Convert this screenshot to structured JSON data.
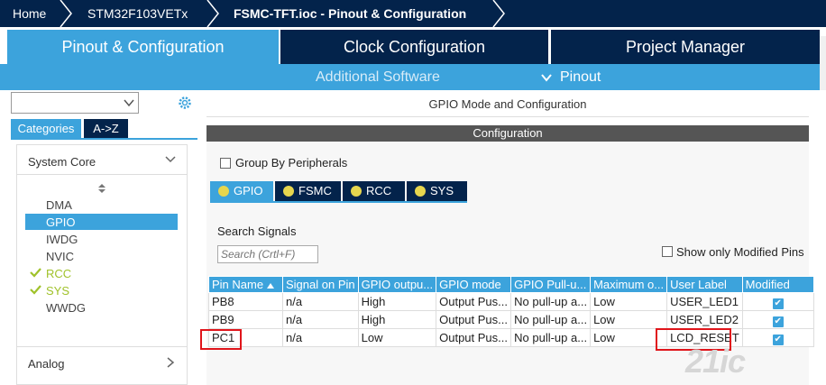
{
  "breadcrumb": {
    "home": "Home",
    "mcu": "STM32F103VETx",
    "file": "FSMC-TFT.ioc - Pinout & Configuration"
  },
  "tabs": {
    "pinout": "Pinout & Configuration",
    "clock": "Clock Configuration",
    "project": "Project Manager"
  },
  "subbar": {
    "software": "Additional Software",
    "pinout": "Pinout"
  },
  "sidebar": {
    "search_value": "",
    "cat_tabs": [
      "Categories",
      "A->Z"
    ],
    "system_core": "System Core",
    "items": [
      {
        "label": "DMA",
        "status": ""
      },
      {
        "label": "GPIO",
        "status": "selected"
      },
      {
        "label": "IWDG",
        "status": ""
      },
      {
        "label": "NVIC",
        "status": ""
      },
      {
        "label": "RCC",
        "status": "ok"
      },
      {
        "label": "SYS",
        "status": "ok"
      },
      {
        "label": "WWDG",
        "status": ""
      }
    ],
    "analog": "Analog"
  },
  "main": {
    "mode_title": "GPIO Mode and Configuration",
    "config_title": "Configuration",
    "group_by": "Group By Peripherals",
    "ptabs": [
      "GPIO",
      "FSMC",
      "RCC",
      "SYS"
    ],
    "search_label": "Search Signals",
    "search_placeholder": "Search (Crtl+F)",
    "show_modified": "Show only Modified Pins",
    "columns": [
      "Pin Name",
      "Signal on Pin",
      "GPIO outpu...",
      "GPIO mode",
      "GPIO Pull-u...",
      "Maximum o...",
      "User Label",
      "Modified"
    ],
    "rows": [
      [
        "PB8",
        "n/a",
        "High",
        "Output Pus...",
        "No pull-up a...",
        "Low",
        "USER_LED1",
        true
      ],
      [
        "PB9",
        "n/a",
        "High",
        "Output Pus...",
        "No pull-up a...",
        "Low",
        "USER_LED2",
        true
      ],
      [
        "PC1",
        "n/a",
        "Low",
        "Output Pus...",
        "No pull-up a...",
        "Low",
        "LCD_RESET",
        true
      ]
    ]
  },
  "watermark": "21ic",
  "colors": {
    "navy": "#03234b",
    "blue": "#3ca3dc",
    "ok": "#a0c22a",
    "highlight": "#e0151b"
  }
}
